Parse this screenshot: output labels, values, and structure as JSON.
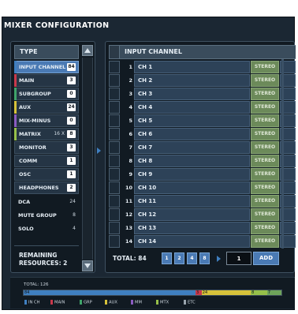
{
  "window": {
    "title": "MIXER CONFIGURATION"
  },
  "type_panel": {
    "header": "TYPE",
    "items": [
      {
        "label": "INPUT CHANNEL",
        "count": "84",
        "color": "#3f7fc0",
        "selected": true
      },
      {
        "label": "MAIN",
        "count": "3",
        "color": "#c8394c"
      },
      {
        "label": "SUBGROUP",
        "count": "0",
        "color": "#3fa46a"
      },
      {
        "label": "AUX",
        "count": "24",
        "color": "#d6c23a"
      },
      {
        "label": "MIX-MINUS",
        "count": "0",
        "color": "#8a5cc0"
      },
      {
        "label": "MATRIX",
        "prefix": "16 X",
        "count": "8",
        "color": "#97c04a"
      },
      {
        "label": "MONITOR",
        "count": "3",
        "color": ""
      },
      {
        "label": "COMM",
        "count": "1",
        "color": ""
      },
      {
        "label": "OSC",
        "count": "1",
        "color": ""
      },
      {
        "label": "HEADPHONES",
        "count": "2",
        "color": ""
      }
    ],
    "plain_items": [
      {
        "label": "DCA",
        "count": "24"
      },
      {
        "label": "MUTE GROUP",
        "count": "8"
      },
      {
        "label": "SOLO",
        "count": "4"
      }
    ],
    "remaining_line1": "REMAINING",
    "remaining_line2": "RESOURCES: 2"
  },
  "channel_panel": {
    "header": "INPUT CHANNEL",
    "rows": [
      {
        "num": "1",
        "name": "CH 1",
        "mode": "STEREO"
      },
      {
        "num": "2",
        "name": "CH 2",
        "mode": "STEREO"
      },
      {
        "num": "3",
        "name": "CH 3",
        "mode": "STEREO"
      },
      {
        "num": "4",
        "name": "CH 4",
        "mode": "STEREO"
      },
      {
        "num": "5",
        "name": "CH 5",
        "mode": "STEREO"
      },
      {
        "num": "6",
        "name": "CH 6",
        "mode": "STEREO"
      },
      {
        "num": "7",
        "name": "CH 7",
        "mode": "STEREO"
      },
      {
        "num": "8",
        "name": "CH 8",
        "mode": "STEREO"
      },
      {
        "num": "9",
        "name": "CH 9",
        "mode": "STEREO"
      },
      {
        "num": "10",
        "name": "CH 10",
        "mode": "STEREO"
      },
      {
        "num": "11",
        "name": "CH 11",
        "mode": "STEREO"
      },
      {
        "num": "12",
        "name": "CH 12",
        "mode": "STEREO"
      },
      {
        "num": "13",
        "name": "CH 13",
        "mode": "STEREO"
      },
      {
        "num": "14",
        "name": "CH 14",
        "mode": "STEREO"
      }
    ],
    "total": "TOTAL: 84",
    "pages": [
      "1",
      "2",
      "4",
      "8"
    ],
    "add_value": "1",
    "add_label": "ADD"
  },
  "resources": {
    "total": "TOTAL: 126",
    "segments": [
      {
        "label": "84",
        "value": 84,
        "color": "#3f7fc0"
      },
      {
        "label": "3",
        "value": 3,
        "color": "#c8394c"
      },
      {
        "label": "24",
        "value": 24,
        "color": "#d6c23a"
      },
      {
        "label": "8",
        "value": 8,
        "color": "#97c04a"
      },
      {
        "label": "7",
        "value": 7,
        "color": "#6ea35a"
      }
    ],
    "legend": [
      {
        "label": "IN CH",
        "color": "#3f7fc0"
      },
      {
        "label": "MAIN",
        "color": "#c8394c"
      },
      {
        "label": "GRP",
        "color": "#3fa46a"
      },
      {
        "label": "AUX",
        "color": "#d6c23a"
      },
      {
        "label": "MM",
        "color": "#8a5cc0"
      },
      {
        "label": "MTX",
        "color": "#97c04a"
      },
      {
        "label": "ETC",
        "color": "#9aa5ae"
      }
    ]
  }
}
